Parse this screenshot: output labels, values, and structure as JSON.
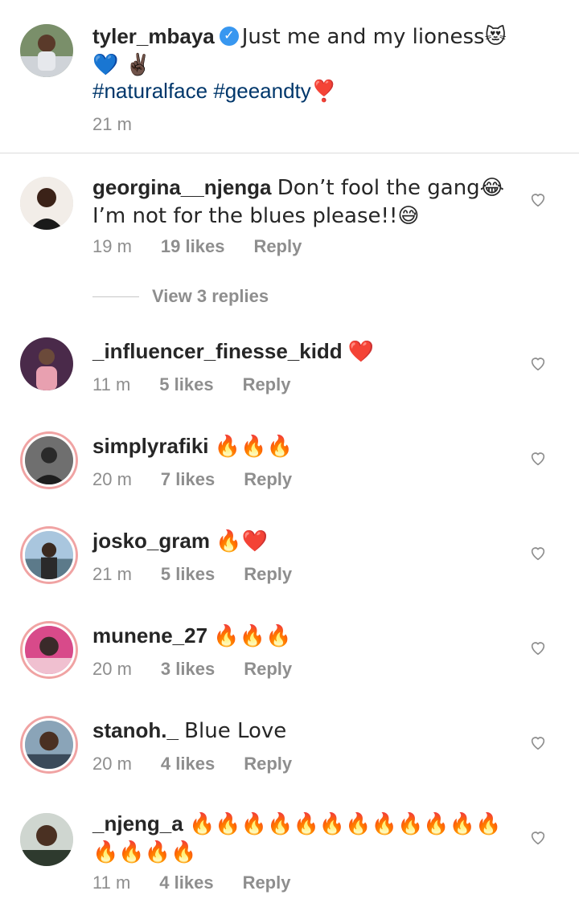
{
  "post": {
    "username": "tyler_mbaya",
    "verified_icon": "verified-badge-icon",
    "caption": "Just me and my lioness😻💙 ✌🏿",
    "hashtags": "#naturalface #geeandty❣️",
    "time": "21 m"
  },
  "comments": [
    {
      "username": "georgina__njenga",
      "text": "Don’t fool the gang😂I’m not for the blues please!!😅",
      "time": "19 m",
      "likes": "19 likes",
      "reply": "Reply"
    },
    {
      "username": "_influencer_finesse_kidd",
      "text": "❤️",
      "time": "11 m",
      "likes": "5 likes",
      "reply": "Reply"
    },
    {
      "username": "simplyrafiki",
      "text": "🔥🔥🔥",
      "time": "20 m",
      "likes": "7 likes",
      "reply": "Reply"
    },
    {
      "username": "josko_gram",
      "text": "🔥❤️",
      "time": "21 m",
      "likes": "5 likes",
      "reply": "Reply"
    },
    {
      "username": "munene_27",
      "text": "🔥🔥🔥",
      "time": "20 m",
      "likes": "3 likes",
      "reply": "Reply"
    },
    {
      "username": "stanoh._",
      "text": "Blue Love",
      "time": "20 m",
      "likes": "4 likes",
      "reply": "Reply"
    },
    {
      "username": "_njeng_a",
      "text": "🔥🔥🔥🔥🔥🔥🔥🔥🔥🔥🔥🔥🔥🔥🔥🔥",
      "time": "11 m",
      "likes": "4 likes",
      "reply": "Reply"
    }
  ],
  "view_replies": "View 3 replies",
  "colors": {
    "accent_link": "#00376b",
    "verified": "#3897f0",
    "meta": "#8e8e8e"
  }
}
